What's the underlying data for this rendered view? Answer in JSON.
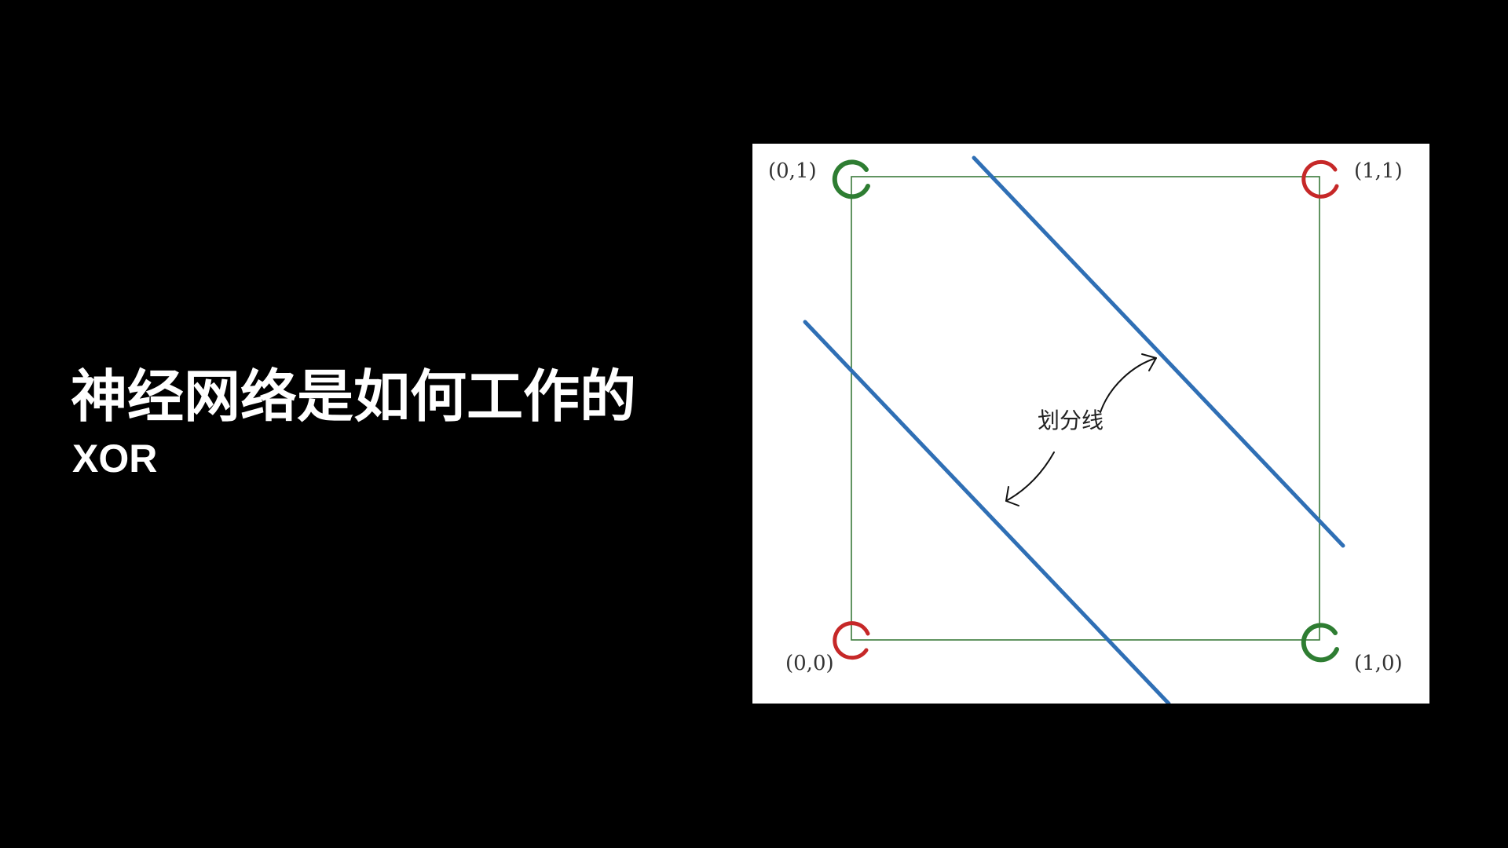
{
  "slide": {
    "title": "神经网络是如何工作的",
    "subtitle": "XOR"
  },
  "diagram": {
    "points": [
      {
        "label": "(0,1)",
        "class": "green"
      },
      {
        "label": "(1,1)",
        "class": "red"
      },
      {
        "label": "(0,0)",
        "class": "red"
      },
      {
        "label": "(1,0)",
        "class": "green"
      }
    ],
    "annotation": "划分线",
    "colors": {
      "green": "#2e7d32",
      "red": "#c62828",
      "line": "#2f6fb5",
      "square": "#3a7a3a"
    }
  }
}
